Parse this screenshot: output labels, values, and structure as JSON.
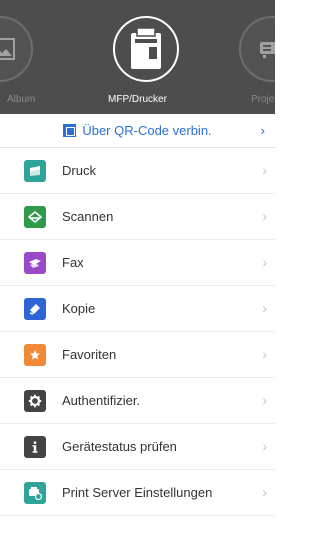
{
  "devices": {
    "left": {
      "label": "Album",
      "icon": "photo-album-icon"
    },
    "active": {
      "label": "MFP/Drucker",
      "icon": "mfp-printer-icon"
    },
    "right": {
      "label": "Proje",
      "icon": "projector-icon"
    }
  },
  "qr": {
    "label": "Über QR-Code verbin.",
    "icon": "qr-code-icon",
    "chevron": "›",
    "color": "#2b6fd6"
  },
  "menu": [
    {
      "label": "Druck",
      "icon": "print-icon",
      "color": "#2fa59a",
      "chevron": "›"
    },
    {
      "label": "Scannen",
      "icon": "scan-icon",
      "color": "#2f9a4c",
      "chevron": "›"
    },
    {
      "label": "Fax",
      "icon": "fax-icon",
      "color": "#9a49c7",
      "chevron": "›"
    },
    {
      "label": "Kopie",
      "icon": "copy-icon",
      "color": "#2f64d6",
      "chevron": "›"
    },
    {
      "label": "Favoriten",
      "icon": "star-icon",
      "color": "#f08a36",
      "chevron": "›"
    },
    {
      "label": "Authentifizier.",
      "icon": "gear-icon",
      "color": "#444444",
      "chevron": "›"
    },
    {
      "label": "Gerätestatus prüfen",
      "icon": "info-icon",
      "color": "#444444",
      "chevron": "›"
    },
    {
      "label": "Print Server Einstellungen",
      "icon": "print-server-icon",
      "color": "#2fa59a",
      "chevron": "›"
    }
  ]
}
